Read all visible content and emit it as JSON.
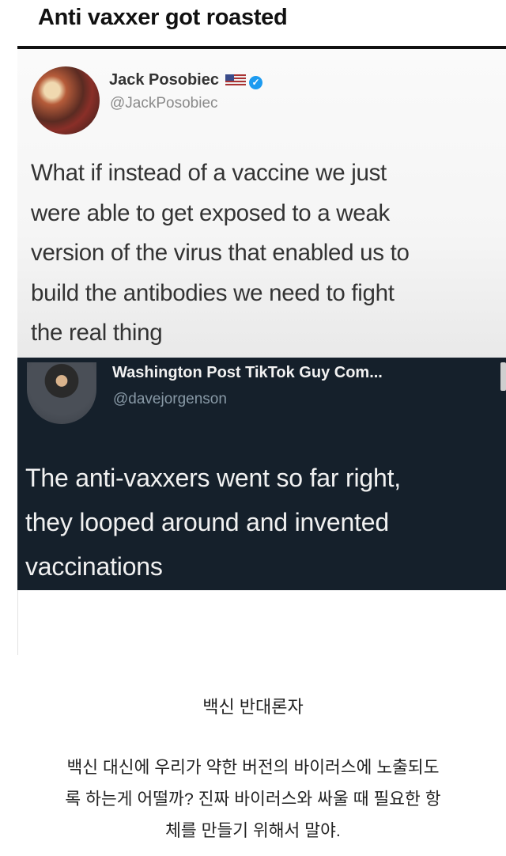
{
  "post": {
    "title": "Anti vaxxer got roasted"
  },
  "tweet_original": {
    "author_name": "Jack Posobiec",
    "handle": "@JackPosobiec",
    "lines": [
      "What if instead of a vaccine we just",
      "were able to get exposed to a weak",
      "version of the virus that enabled us to",
      "build the antibodies we need to fight",
      "the real thing"
    ]
  },
  "tweet_reply": {
    "author_name": "Washington Post TikTok Guy Com...",
    "handle": "@davejorgenson",
    "lines": [
      "The anti-vaxxers went so far right,",
      "they looped around and invented",
      "vaccinations"
    ]
  },
  "caption": "백신 반대론자",
  "translation": {
    "lines": [
      "백신 대신에 우리가 약한 버전의 바이러스에 노출되도",
      "록 하는게 어떨까? 진짜 바이러스와 싸울 때 필요한 항",
      "체를 만들기 위해서 말야."
    ]
  },
  "colors": {
    "dark_tweet_bg": "#15202b",
    "verified_blue": "#1d9bf0"
  }
}
